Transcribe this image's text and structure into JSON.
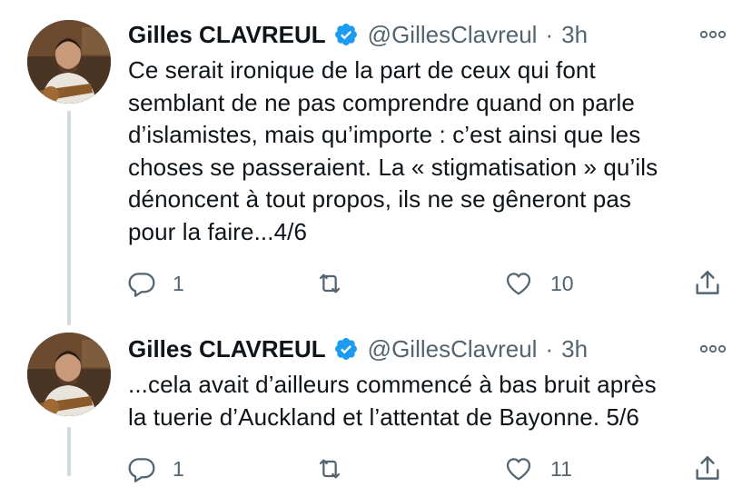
{
  "tweets": [
    {
      "author": {
        "name": "Gilles CLAVREUL",
        "handle": "@GillesClavreul",
        "verified": true
      },
      "separator": "·",
      "time": "3h",
      "text": "Ce serait ironique de la part de ceux qui font\nsemblant de ne pas comprendre quand on parle\nd’islamistes, mais qu’importe : c’est ainsi que les\nchoses se passeraient. La « stigmatisation » qu’ils\ndénoncent à tout propos, ils ne se gêneront pas\npour la faire...4/6",
      "actions": {
        "replies": "1",
        "retweets": "",
        "likes": "10"
      }
    },
    {
      "author": {
        "name": "Gilles CLAVREUL",
        "handle": "@GillesClavreul",
        "verified": true
      },
      "separator": "·",
      "time": "3h",
      "text": "...cela avait d’ailleurs commencé à bas bruit après\nla tuerie d’Auckland et l’attentat de Bayonne. 5/6",
      "actions": {
        "replies": "1",
        "retweets": "",
        "likes": "11"
      }
    }
  ],
  "icons": {
    "more": "more-horizontal-icon",
    "reply": "reply-icon",
    "retweet": "retweet-icon",
    "like": "like-icon",
    "share": "share-icon",
    "verified": "verified-badge-icon"
  },
  "colors": {
    "verified": "#1d9bf0",
    "text": "#0f1419",
    "muted": "#536471",
    "thread_line": "#cfd9de"
  }
}
